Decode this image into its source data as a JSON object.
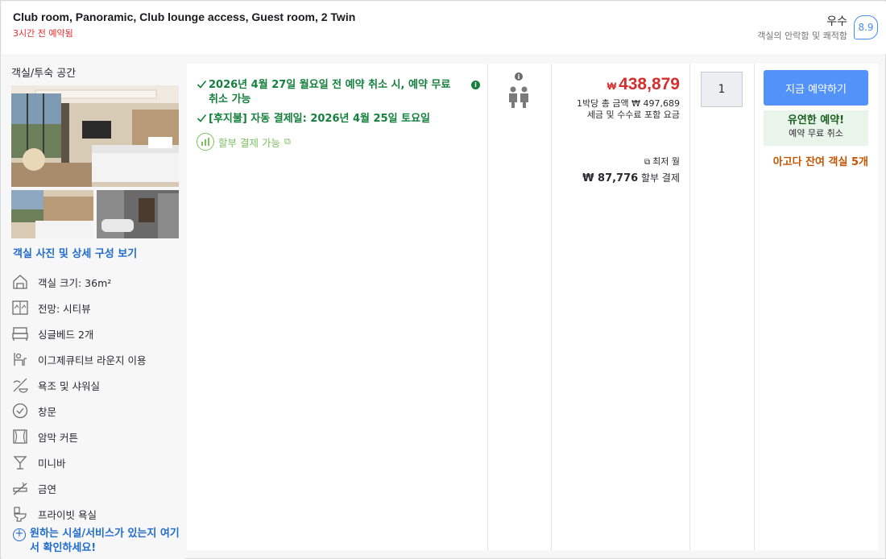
{
  "header": {
    "room_title": "Club room, Panoramic, Club lounge access, Guest room, 2 Twin",
    "booked_recent": "3시간 전 예약됨",
    "rating_word": "우수",
    "rating_sub": "객실의 안락함 및 쾌적함",
    "rating_score": "8.9"
  },
  "left": {
    "title": "객실/투숙 공간",
    "photo_link": "객실 사진 및 상세 구성 보기",
    "features": [
      {
        "icon": "room-size-icon",
        "label": "객실 크기: 36m²"
      },
      {
        "icon": "view-icon",
        "label": "전망: 시티뷰"
      },
      {
        "icon": "bed-icon",
        "label": "싱글베드 2개"
      },
      {
        "icon": "lounge-icon",
        "label": "이그제큐티브 라운지 이용"
      },
      {
        "icon": "bath-shower-icon",
        "label": "욕조 및 샤워실"
      },
      {
        "icon": "window-icon",
        "label": "창문"
      },
      {
        "icon": "blackout-curtain-icon",
        "label": "암막 커튼"
      },
      {
        "icon": "minibar-icon",
        "label": "미니바"
      },
      {
        "icon": "no-smoking-icon",
        "label": "금연"
      },
      {
        "icon": "private-bathroom-icon",
        "label": "프라이빗 욕실"
      }
    ],
    "more_facilities": "원하는 시설/서비스가 있는지 여기서 확인하세요!"
  },
  "benefits": {
    "cancel": "2026년 4월 27일 월요일 전 예약 취소 시, 예약 무료 취소 가능",
    "pay_later": "[후지불] 자동 결제일: 2026년 4월 25일 토요일",
    "installment": "할부 결제 가능"
  },
  "price": {
    "currency_symbol": "₩",
    "per_night": "438,879",
    "total": "1박당 총 금액 ₩ 497,689",
    "tax_note": "세금 및 수수료 포함 요금",
    "monthly_label": "최저 월",
    "monthly_amount": "₩ 87,776",
    "monthly_suffix": "할부 결제"
  },
  "booking": {
    "quantity": "1",
    "book_now": "지금 예약하기",
    "flex_title": "유연한 예약!",
    "flex_sub": "예약 무료 취소",
    "rooms_left": "아고다 잔여 객실 5개"
  },
  "colors": {
    "accent_blue": "#5392f9",
    "price_red": "#d32f2f",
    "benefit_green": "#15803d",
    "urgency_orange": "#c45500"
  }
}
